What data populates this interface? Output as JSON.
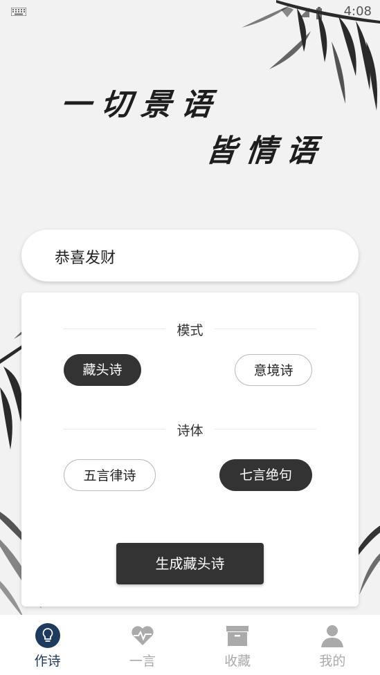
{
  "status_bar": {
    "time": "4:08"
  },
  "banner": {
    "line1": "一切景语",
    "line2": "皆情语"
  },
  "input": {
    "value": "恭喜发财"
  },
  "options": {
    "mode_title": "模式",
    "modes": [
      "藏头诗",
      "意境诗"
    ],
    "selected_mode": "藏头诗",
    "style_title": "诗体",
    "styles": [
      "五言律诗",
      "七言绝句"
    ],
    "selected_style": "七言绝句",
    "generate_label": "生成藏头诗"
  },
  "nav": {
    "items": [
      {
        "label": "作诗",
        "icon": "lightbulb-icon",
        "active": true
      },
      {
        "label": "一言",
        "icon": "heartbeat-icon",
        "active": false
      },
      {
        "label": "收藏",
        "icon": "archive-box-icon",
        "active": false
      },
      {
        "label": "我的",
        "icon": "person-icon",
        "active": false
      }
    ]
  },
  "colors": {
    "active_nav": "#1f3a5f",
    "button_dark": "#333333",
    "background": "#f2f2f2"
  }
}
